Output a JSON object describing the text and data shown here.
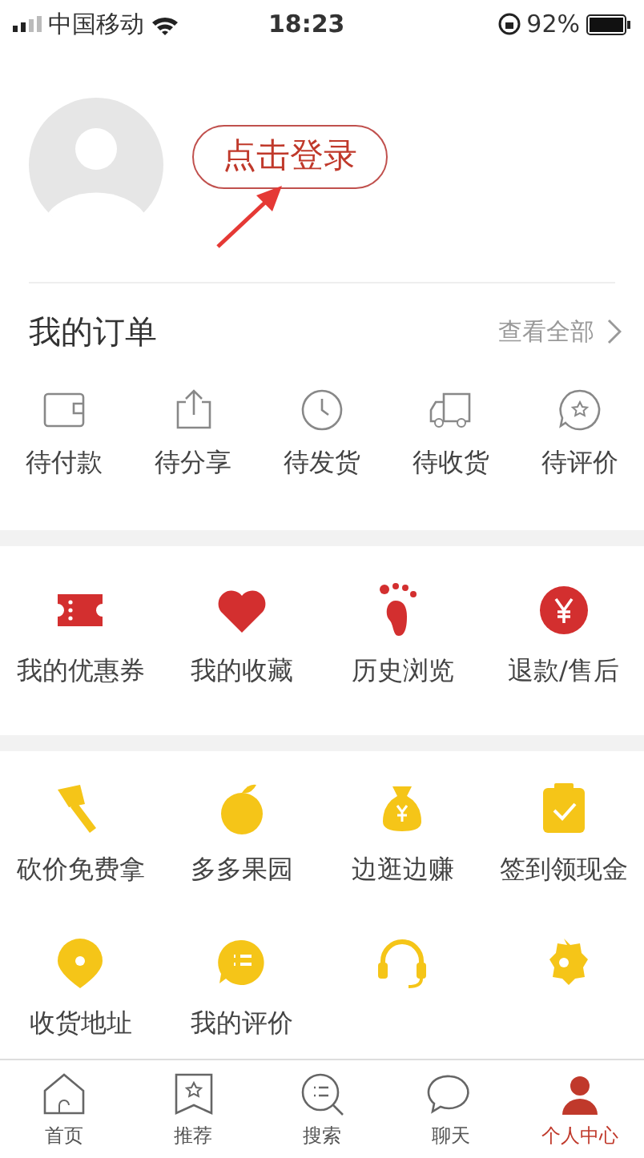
{
  "status_bar": {
    "carrier": "中国移动",
    "time": "18:23",
    "battery": "92%"
  },
  "profile": {
    "login_button": "点击登录"
  },
  "orders": {
    "title": "我的订单",
    "view_all": "查看全部",
    "items": [
      {
        "label": "待付款"
      },
      {
        "label": "待分享"
      },
      {
        "label": "待发货"
      },
      {
        "label": "待收货"
      },
      {
        "label": "待评价"
      }
    ]
  },
  "shortcuts": [
    {
      "label": "我的优惠券"
    },
    {
      "label": "我的收藏"
    },
    {
      "label": "历史浏览"
    },
    {
      "label": "退款/售后"
    }
  ],
  "services": [
    {
      "kind": "labeled",
      "label": "砍价免费拿"
    },
    {
      "kind": "labeled",
      "label": "多多果园"
    },
    {
      "kind": "labeled",
      "label": "边逛边赚"
    },
    {
      "kind": "labeled",
      "label": "签到领现金"
    },
    {
      "kind": "labeled",
      "label": "收货地址"
    },
    {
      "kind": "labeled",
      "label": "我的评价"
    },
    {
      "kind": "icon_only"
    },
    {
      "kind": "icon_only"
    }
  ],
  "tab_bar": [
    {
      "label": "首页",
      "selected": false
    },
    {
      "label": "推荐",
      "selected": false
    },
    {
      "label": "搜索",
      "selected": false
    },
    {
      "label": "聊天",
      "selected": false
    },
    {
      "label": "个人中心",
      "selected": true
    }
  ]
}
